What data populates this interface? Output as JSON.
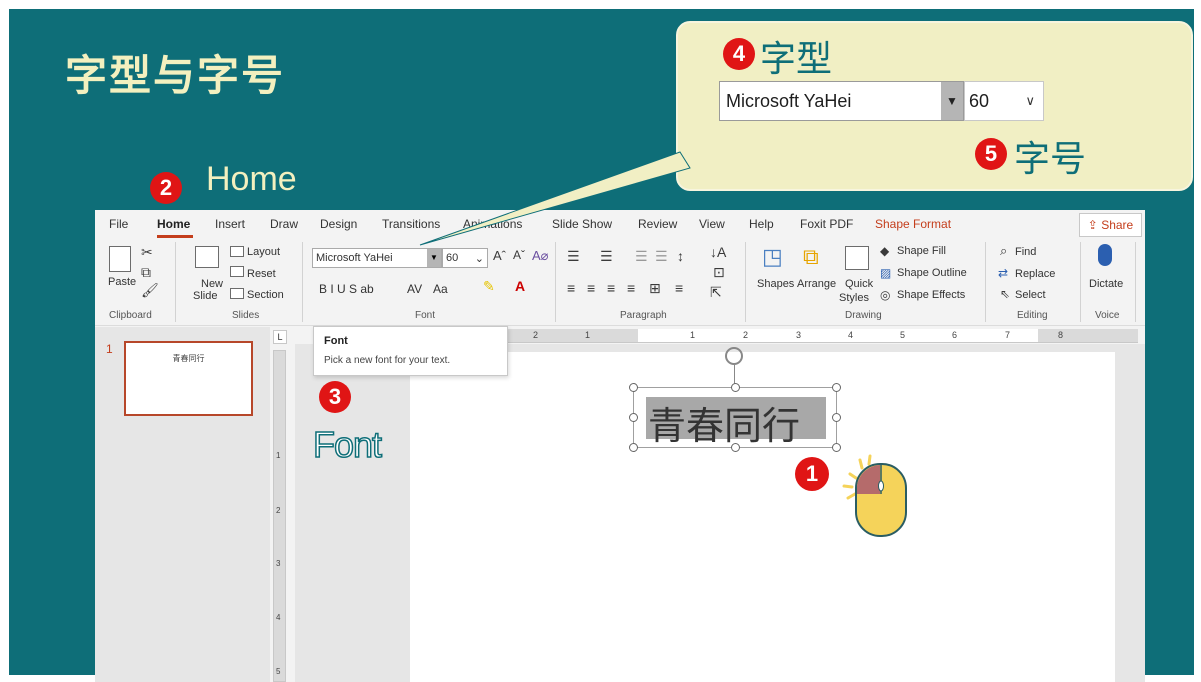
{
  "slide": {
    "title": "字型与字号",
    "home_label": "Home",
    "font_label": "Font",
    "callout": {
      "step4_label": "字型",
      "step5_label": "字号",
      "font_name": "Microsoft YaHei",
      "font_size": "60"
    },
    "steps": [
      "1",
      "2",
      "3",
      "4",
      "5"
    ]
  },
  "ppt": {
    "tabs": [
      "File",
      "Home",
      "Insert",
      "Draw",
      "Design",
      "Transitions",
      "Animations",
      "Slide Show",
      "Review",
      "View",
      "Help",
      "Foxit PDF",
      "Shape Format"
    ],
    "share_label": "Share",
    "clipboard": {
      "paste": "Paste",
      "group": "Clipboard"
    },
    "slides": {
      "new_slide": "New",
      "new_slide2": "Slide",
      "layout": "Layout",
      "reset": "Reset",
      "section": "Section",
      "group": "Slides"
    },
    "font": {
      "name": "Microsoft YaHei",
      "size": "60",
      "format_row": "B  I  U  S  ab",
      "aa": "Aa",
      "group": "Font"
    },
    "paragraph": {
      "group": "Paragraph"
    },
    "drawing": {
      "shapes": "Shapes",
      "arrange": "Arrange",
      "quick": "Quick",
      "styles": "Styles",
      "shape_fill": "Shape Fill",
      "shape_outline": "Shape Outline",
      "shape_effects": "Shape Effects",
      "group": "Drawing"
    },
    "editing": {
      "find": "Find",
      "replace": "Replace",
      "select": "Select",
      "group": "Editing"
    },
    "voice": {
      "dictate": "Dictate",
      "group": "Voice"
    },
    "tooltip": {
      "title": "Font",
      "desc": "Pick a new font for your text."
    },
    "thumbnail": {
      "number": "1",
      "text": "青春同行"
    },
    "ruler_h": [
      "2",
      "1",
      "1",
      "2",
      "3",
      "4",
      "5",
      "6",
      "7",
      "8"
    ],
    "ruler_v": [
      "1",
      "2",
      "3",
      "4",
      "5"
    ],
    "textbox_text": "青春同行"
  },
  "colors": {
    "slide_bg": "#0e6e78",
    "title_color": "#f3f0bf",
    "callout_bg": "#f1efc4",
    "step_circle": "#e01515",
    "accent": "#c43e1c",
    "mouse_body": "#f5d35a",
    "mouse_button": "#b56b6b"
  }
}
